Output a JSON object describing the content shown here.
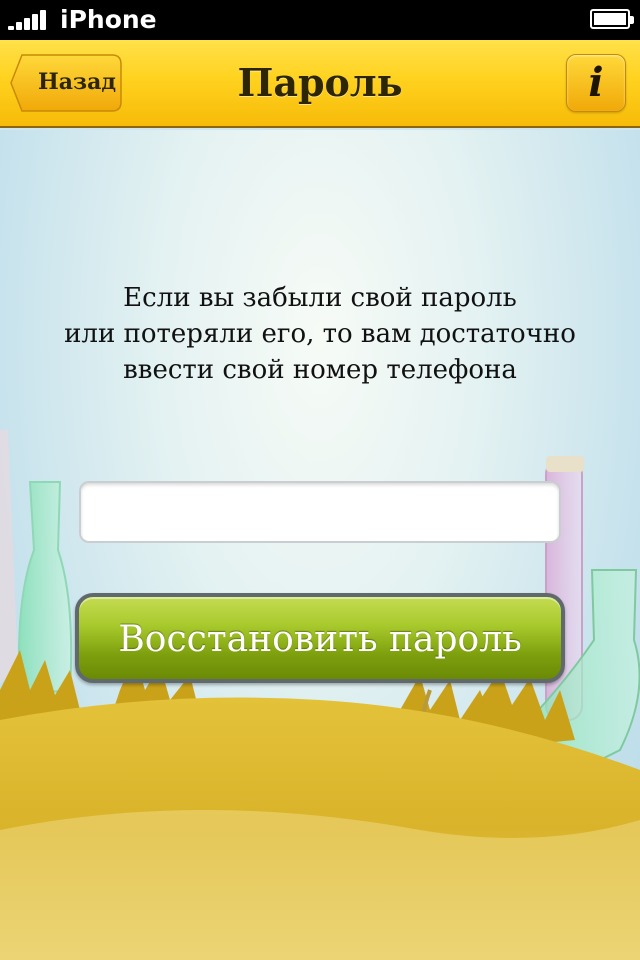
{
  "status_bar": {
    "carrier": "iPhone",
    "signal_bars": 5,
    "battery_level": 1.0
  },
  "nav": {
    "title": "Пароль",
    "back_label": "Назад",
    "info_icon": "i"
  },
  "main": {
    "instruction_lines": [
      "Если вы забыли свой пароль",
      "или потеряли его, то вам достаточно",
      "ввести свой номер телефона"
    ],
    "phone_input": {
      "value": "",
      "placeholder": ""
    },
    "restore_button_label": "Восстановить пароль"
  },
  "colors": {
    "nav_accent": "#ffd21f",
    "button_green": "#8fb31a"
  }
}
